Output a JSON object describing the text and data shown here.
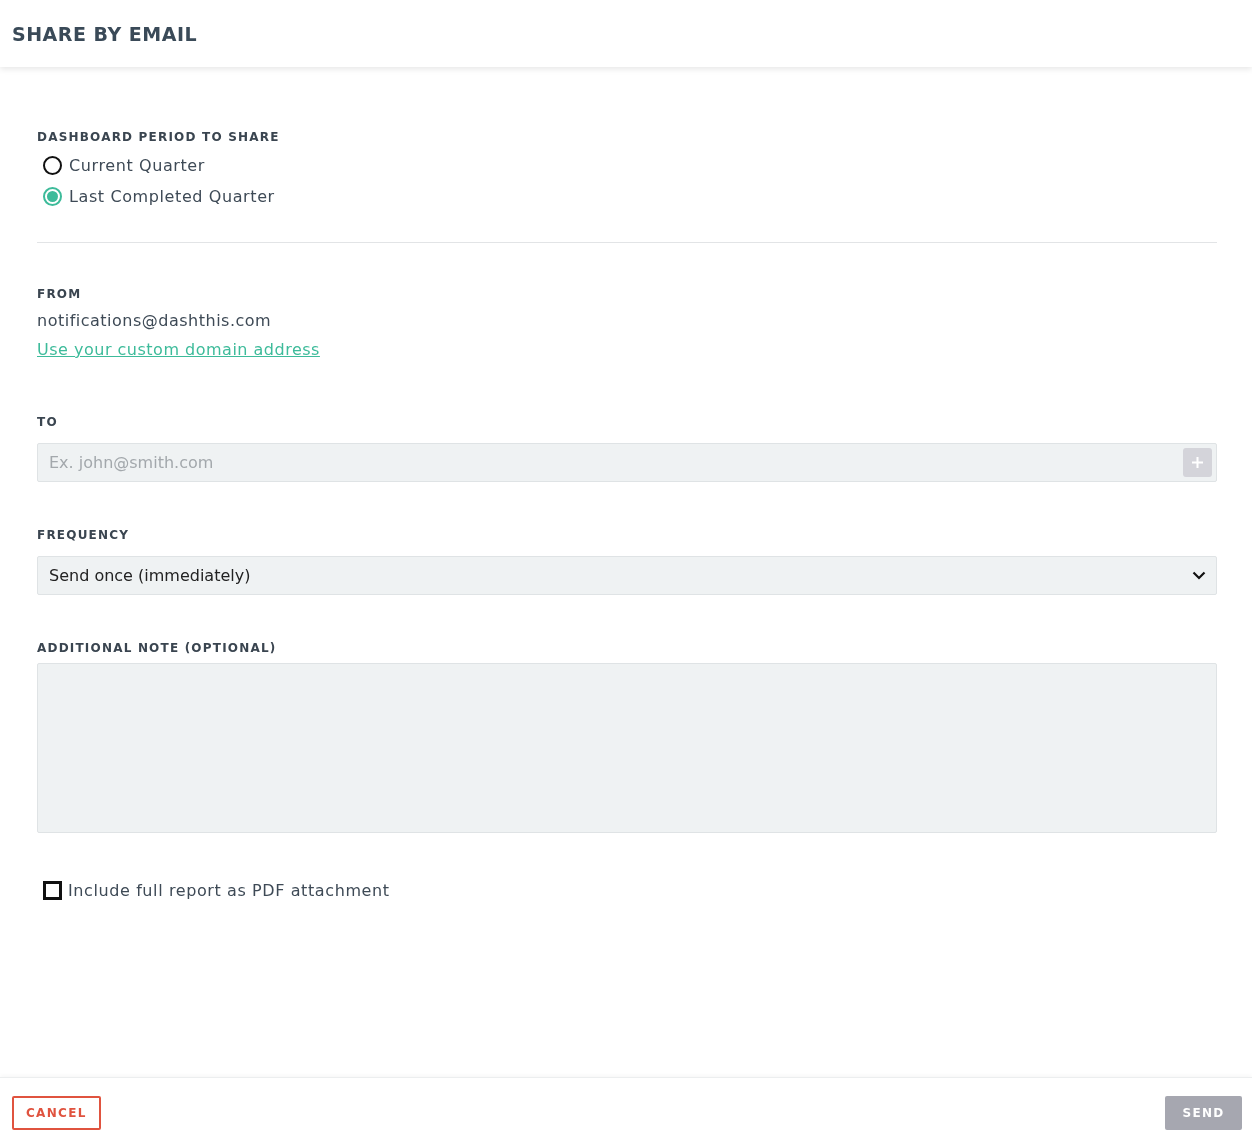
{
  "header": {
    "title": "SHARE BY EMAIL"
  },
  "period": {
    "label": "DASHBOARD PERIOD TO SHARE",
    "options": [
      {
        "label": "Current Quarter",
        "selected": false
      },
      {
        "label": "Last Completed Quarter",
        "selected": true
      }
    ]
  },
  "from": {
    "label": "FROM",
    "address": "notifications@dashthis.com",
    "link": "Use your custom domain address"
  },
  "to": {
    "label": "TO",
    "placeholder": "Ex. john@smith.com"
  },
  "frequency": {
    "label": "FREQUENCY",
    "value": "Send once (immediately)"
  },
  "note": {
    "label": "ADDITIONAL NOTE (OPTIONAL)"
  },
  "attachment": {
    "label": "Include full report as PDF attachment",
    "checked": false
  },
  "footer": {
    "cancel": "CANCEL",
    "send": {
      "label": "SEND",
      "disabled": true
    }
  }
}
